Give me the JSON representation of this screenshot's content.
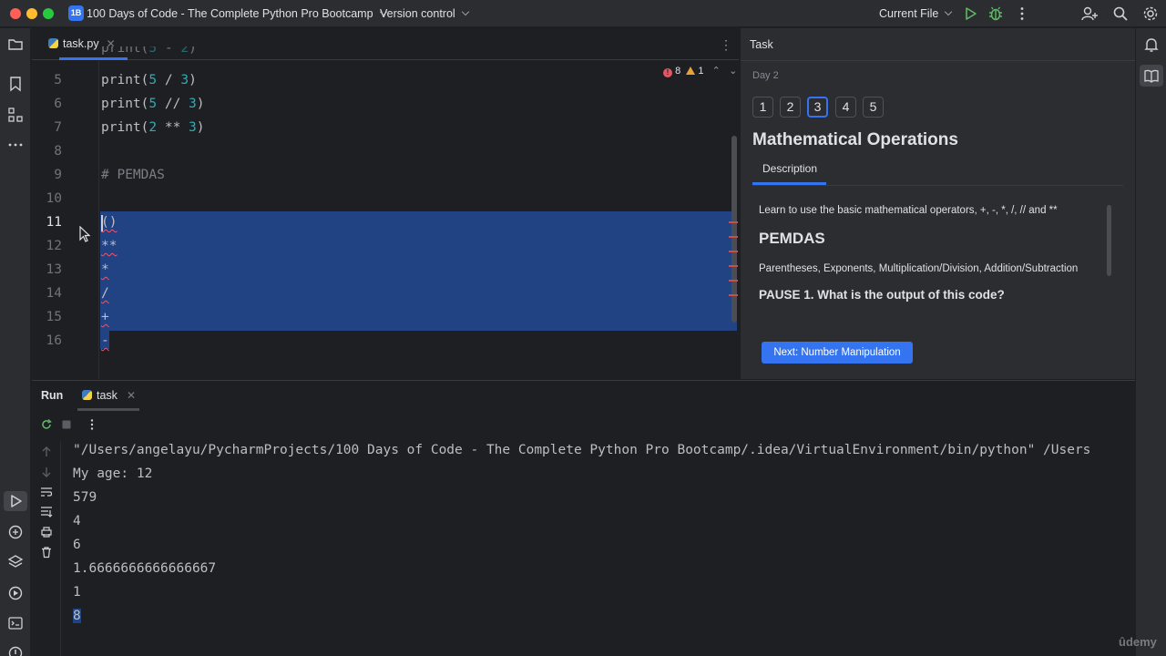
{
  "titlebar": {
    "project_badge": "1B",
    "project_name": "100 Days of Code - The Complete Python Pro Bootcamp",
    "version_control": "Version control",
    "run_config": "Current File"
  },
  "editor": {
    "tab_name": "task.py",
    "inspections": {
      "errors": "8",
      "warnings": "1"
    },
    "lines": [
      {
        "n": "5",
        "code": [
          "print(",
          "5",
          " / ",
          "3",
          ")"
        ]
      },
      {
        "n": "6",
        "code": [
          "print(",
          "5",
          " // ",
          "3",
          ")"
        ]
      },
      {
        "n": "7",
        "code": [
          "print(",
          "2",
          " ** ",
          "3",
          ")"
        ]
      },
      {
        "n": "8",
        "code": ""
      },
      {
        "n": "9",
        "code": "# PEMDAS"
      },
      {
        "n": "10",
        "code": ""
      },
      {
        "n": "11",
        "code": "()"
      },
      {
        "n": "12",
        "code": "**"
      },
      {
        "n": "13",
        "code": "*"
      },
      {
        "n": "14",
        "code": "/"
      },
      {
        "n": "15",
        "code": "+"
      },
      {
        "n": "16",
        "code": "-"
      }
    ]
  },
  "task": {
    "header": "Task",
    "day": "Day 2",
    "steps": [
      "1",
      "2",
      "3",
      "4",
      "5"
    ],
    "active_step": "3",
    "title": "Mathematical Operations",
    "description_tab": "Description",
    "intro": "Learn to use the basic mathematical operators, +, -, *, /, // and **",
    "heading": "PEMDAS",
    "pemdas_text": "Parentheses, Exponents, Multiplication/Division, Addition/Subtraction",
    "pause_heading": "PAUSE 1. What is the output of this code?",
    "next_button": "Next: Number Manipulation"
  },
  "run": {
    "title": "Run",
    "tab": "task",
    "output": [
      "\"/Users/angelayu/PycharmProjects/100 Days of Code - The Complete Python Pro Bootcamp/.idea/VirtualEnvironment/bin/python\" /Users",
      "My age: 12",
      "579",
      "4",
      "6",
      "1.6666666666666667",
      "1",
      "8"
    ]
  },
  "watermark": "ûdemy",
  "colors": {
    "accent": "#3574f0",
    "selection": "#214283",
    "number": "#2aacb8",
    "error": "#e55765",
    "warning": "#e9a23b"
  }
}
